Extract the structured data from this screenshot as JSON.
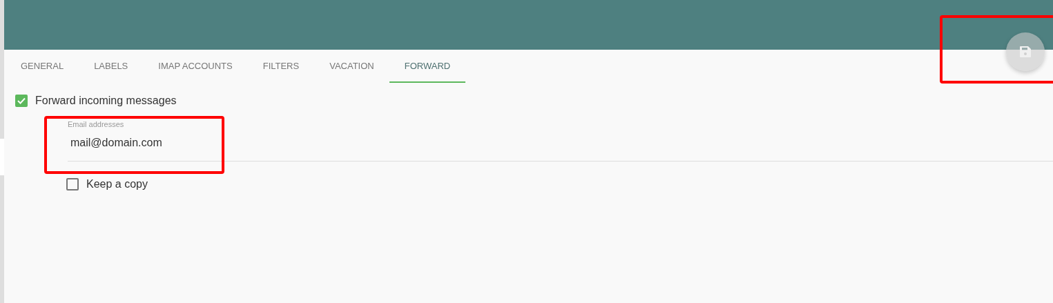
{
  "tabs": [
    {
      "label": "GENERAL",
      "selected": false
    },
    {
      "label": "LABELS",
      "selected": false
    },
    {
      "label": "IMAP ACCOUNTS",
      "selected": false
    },
    {
      "label": "FILTERS",
      "selected": false
    },
    {
      "label": "VACATION",
      "selected": false
    },
    {
      "label": "FORWARD",
      "selected": true
    }
  ],
  "save_button": {
    "disabled": true,
    "highlighted": true
  },
  "forward_option": {
    "label": "Forward incoming messages",
    "checked": true
  },
  "email_field": {
    "label": "Email addresses",
    "value": "mail@domain.com",
    "highlighted": true
  },
  "keep_copy_option": {
    "label": "Keep a copy",
    "checked": false
  }
}
